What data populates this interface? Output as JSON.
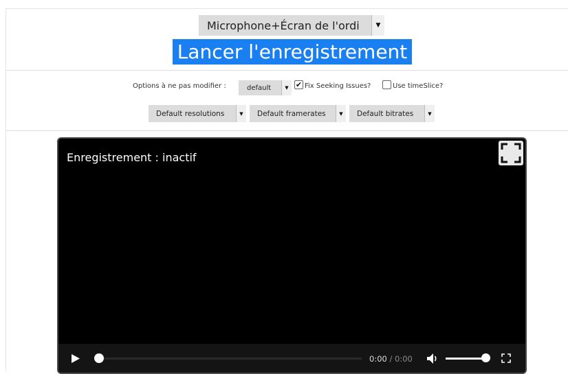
{
  "toolbar": {
    "mode_select": "Microphone+Écran de l'ordi",
    "start_button": "Lancer l'enregistrement"
  },
  "options": {
    "label": "Options à ne pas modifier :",
    "mime_select": "default",
    "fix_seeking_label": "Fix Seeking Issues?",
    "fix_seeking_checked": true,
    "timeslice_label": "Use timeSlice?",
    "timeslice_checked": false,
    "resolutions_select": "Default resolutions",
    "framerates_select": "Default framerates",
    "bitrates_select": "Default bitrates"
  },
  "video": {
    "status": "Enregistrement : inactif",
    "current_time": "0:00",
    "time_separator": " / ",
    "duration": "0:00",
    "progress": 0,
    "volume": 1
  },
  "icons": {
    "select_arrow": "▼",
    "checkmark": "✔"
  },
  "colors": {
    "accent": "#1a7ff0"
  }
}
